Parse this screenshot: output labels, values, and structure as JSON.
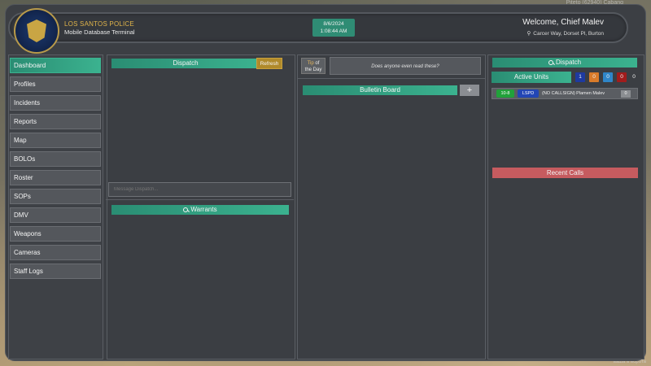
{
  "top_overlay": "Piteto (62940) Cabang",
  "bottom_overlay": "ваша в ворота",
  "bottom_left_overlay": "",
  "header": {
    "org_name": "LOS SANTOS POLICE",
    "org_subtitle": "Mobile Database Terminal",
    "date": "8/6/2024",
    "time": "1:08:44 AM",
    "welcome": "Welcome, Chief Malev",
    "location": "Carcer Way, Dorset Pl, Burton"
  },
  "sidebar": {
    "items": [
      {
        "label": "Dashboard",
        "active": true
      },
      {
        "label": "Profiles"
      },
      {
        "label": "Incidents"
      },
      {
        "label": "Reports"
      },
      {
        "label": "Map"
      },
      {
        "label": "BOLOs"
      },
      {
        "label": "Roster"
      },
      {
        "label": "SOPs"
      },
      {
        "label": "DMV"
      },
      {
        "label": "Weapons"
      },
      {
        "label": "Cameras"
      },
      {
        "label": "Staff Logs"
      }
    ]
  },
  "dispatch_panel": {
    "title": "Dispatch",
    "refresh_label": "Refresh",
    "message_placeholder": "Message Dispatch..."
  },
  "warrants": {
    "title": "Warrants"
  },
  "tip_of_day": {
    "label_a": "Tip",
    "label_b": "of",
    "label_c": "the Day",
    "text": "Does anyone even read these?"
  },
  "bulletin_board": {
    "title": "Bulletin Board",
    "add_label": "+"
  },
  "dispatch_right": {
    "title": "Dispatch",
    "active_units_label": "Active Units",
    "counts": [
      {
        "value": "1",
        "color": "#1e3aa0"
      },
      {
        "value": "0",
        "color": "#d97b2a"
      },
      {
        "value": "0",
        "color": "#2f86c9"
      },
      {
        "value": "0",
        "color": "#a11c1c"
      },
      {
        "value": "0",
        "color": "transparent"
      }
    ],
    "units": [
      {
        "status": "10-8",
        "dept": "LSPD",
        "name": "(NO CALLSIGN) Plamen Malev",
        "count": "0"
      }
    ],
    "recent_calls_label": "Recent Calls"
  }
}
